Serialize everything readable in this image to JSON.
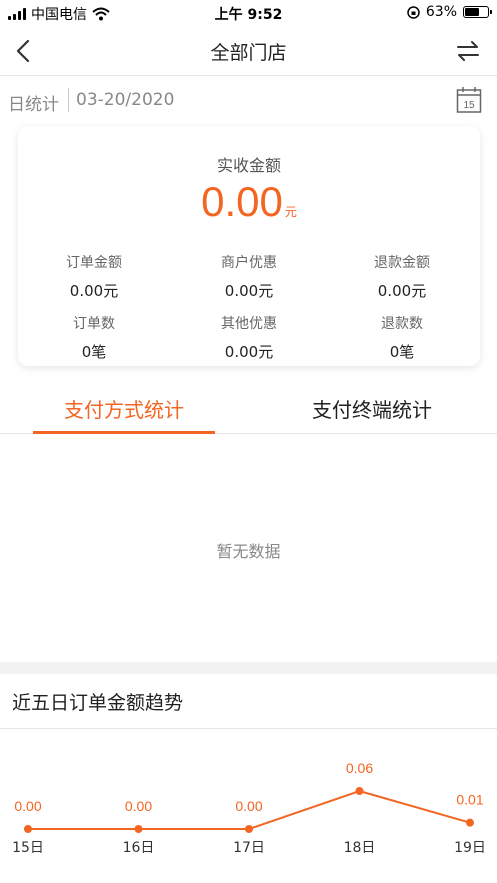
{
  "status": {
    "carrier": "中国电信",
    "time": "上午 9:52",
    "battery": "63%",
    "battery_level": 0.63
  },
  "nav": {
    "title": "全部门店",
    "back_icon": "chevron-left-icon",
    "switch_icon": "swap-arrows-icon"
  },
  "date_row": {
    "label": "日统计",
    "date": "03-20/2020",
    "calendar_day": "15"
  },
  "summary": {
    "main_label": "实收金额",
    "main_amount": "0.00",
    "main_unit": "元",
    "stats": [
      {
        "label": "订单金额",
        "value": "0.00元"
      },
      {
        "label": "商户优惠",
        "value": "0.00元"
      },
      {
        "label": "退款金额",
        "value": "0.00元"
      },
      {
        "label": "订单数",
        "value": "0笔"
      },
      {
        "label": "其他优惠",
        "value": "0.00元"
      },
      {
        "label": "退款数",
        "value": "0笔"
      }
    ]
  },
  "tabs": [
    {
      "label": "支付方式统计",
      "active": true
    },
    {
      "label": "支付终端统计",
      "active": false
    }
  ],
  "empty_message": "暂无数据",
  "trend": {
    "title": "近五日订单金额趋势"
  },
  "colors": {
    "accent": "#f26522"
  },
  "chart_data": {
    "type": "line",
    "categories": [
      "15日",
      "16日",
      "17日",
      "18日",
      "19日"
    ],
    "values": [
      0.0,
      0.0,
      0.0,
      0.06,
      0.01
    ],
    "data_labels": [
      "0.00",
      "0.00",
      "0.00",
      "0.06",
      "0.01"
    ],
    "ylim": [
      0,
      0.06
    ]
  }
}
